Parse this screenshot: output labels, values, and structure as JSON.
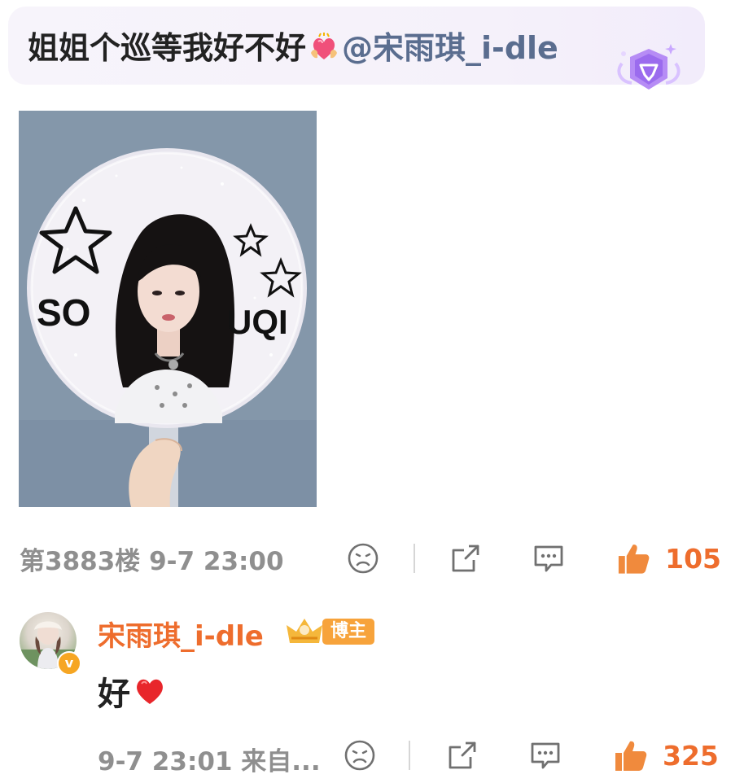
{
  "comment": {
    "text": "姐姐个巡等我好不好",
    "emoji": "heart-with-hands-emoji",
    "mention": "@宋雨琪_i-dle",
    "badge": "purple-gem-badge",
    "photo": {
      "caption_left": "SO",
      "caption_right": "UQI"
    },
    "floor_time": "第3883楼 9-7 23:00",
    "like_count": "105"
  },
  "reply": {
    "author": "宋雨琪_i-dle",
    "author_tag": "博主",
    "verified_mark": "v",
    "body": "好",
    "body_emoji": "red-heart-emoji",
    "time_source": "9-7 23:01 来自...",
    "like_count": "325"
  },
  "colors": {
    "accent": "#ee6d2d",
    "mention": "#5a6d8f",
    "meta_gray": "#8f8f8f",
    "tag": "#f7a33b"
  }
}
